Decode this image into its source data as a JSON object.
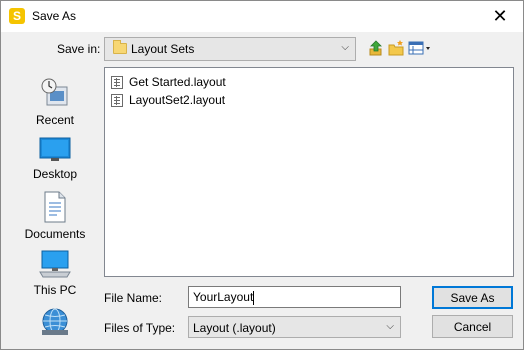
{
  "window": {
    "title": "Save As",
    "app_icon_letter": "S",
    "close_glyph": "✕"
  },
  "toolbar": {
    "save_in_label": "Save in:",
    "save_in_value": "Layout Sets",
    "up_icon": "up-folder-icon",
    "new_folder_icon": "new-folder-icon",
    "view_menu_icon": "view-menu-icon"
  },
  "places": [
    {
      "label": "Recent",
      "icon": "recent-icon"
    },
    {
      "label": "Desktop",
      "icon": "desktop-icon"
    },
    {
      "label": "Documents",
      "icon": "documents-icon"
    },
    {
      "label": "This PC",
      "icon": "this-pc-icon"
    },
    {
      "label": "",
      "icon": "network-icon"
    }
  ],
  "files": [
    {
      "name": "Get Started.layout"
    },
    {
      "name": "LayoutSet2.layout"
    }
  ],
  "form": {
    "file_name_label": "File Name:",
    "file_name_value": "YourLayout",
    "file_type_label": "Files of Type:",
    "file_type_value": "Layout (.layout)"
  },
  "buttons": {
    "save": "Save As",
    "cancel": "Cancel"
  },
  "colors": {
    "accent": "#0078d7",
    "app_icon": "#f5c400",
    "folder": "#f7d774"
  }
}
